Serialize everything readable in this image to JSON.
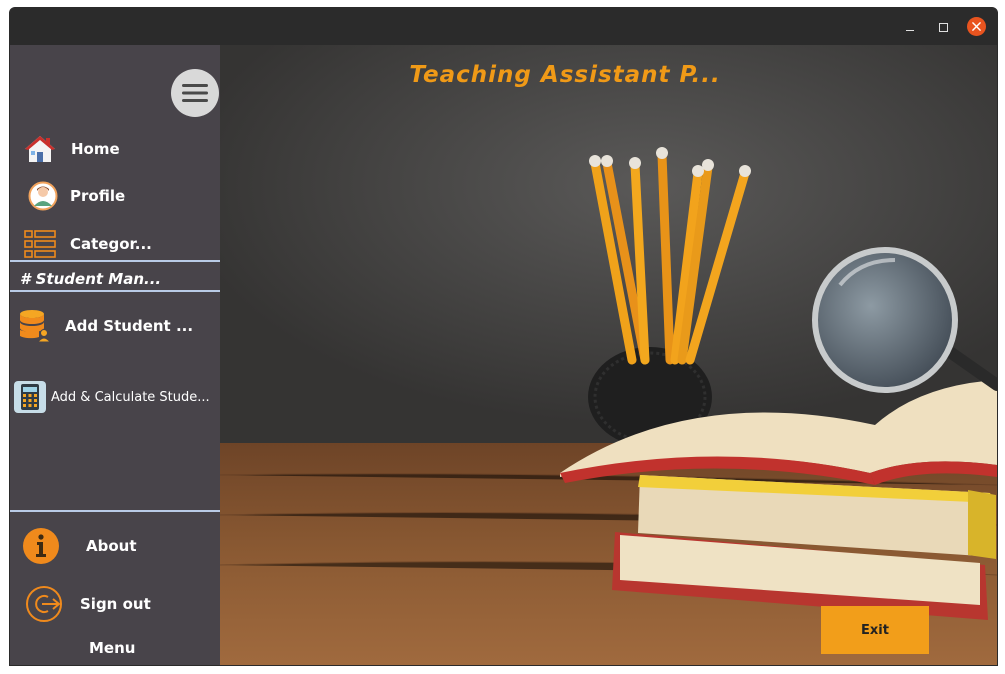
{
  "window": {
    "controls": [
      "minimize-icon",
      "maximize-icon",
      "close-icon"
    ]
  },
  "header": {
    "title": "Teaching Assistant P..."
  },
  "sidebar": {
    "items": [
      {
        "label": "Home",
        "icon": "home-icon"
      },
      {
        "label": "Profile",
        "icon": "profile-icon"
      },
      {
        "label": "Categor...",
        "icon": "list-icon"
      }
    ],
    "section_label": "# Student Man...",
    "student_items": [
      {
        "label": "Add Student ...",
        "icon": "database-user-icon"
      },
      {
        "label": "Add & Calculate Stude...",
        "icon": "calculator-icon"
      }
    ],
    "footer": {
      "about_label": "About",
      "signout_label": "Sign out",
      "menu_label": "Menu"
    }
  },
  "main": {
    "exit_label": "Exit"
  },
  "colors": {
    "accent": "#f29e1a",
    "sidebar_bg": "#48444a",
    "titlebar_bg": "#2b2b2b",
    "close": "#e9541f",
    "separator": "#b9cbe6"
  }
}
